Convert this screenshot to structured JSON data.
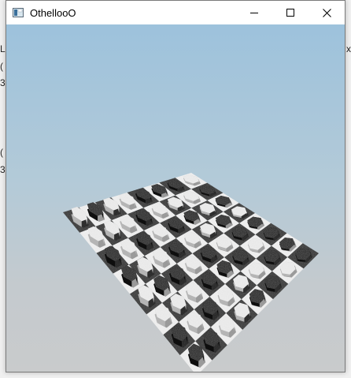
{
  "window": {
    "title": "OthellooO",
    "icon": "app-window-icon",
    "controls": [
      "minimize-icon",
      "maximize-icon",
      "close-icon"
    ]
  },
  "background_window": {
    "fragments": [
      "L",
      "(",
      "3",
      "(",
      "3",
      "x"
    ]
  },
  "board": {
    "size": 8,
    "colors": {
      "dark_square": "#2b2b2b",
      "light_square": "#f2f2f2",
      "black_piece": "#1e1e1e",
      "white_piece": "#eeeeee"
    },
    "rows": [
      "WBBWBBBB",
      "BWWBBWBW",
      "BWBWWBWB",
      "BWBWBBWB",
      "WBWBWBWW",
      "WWBWBWBW",
      "BWWWBWWB",
      "WWBBWWBB"
    ]
  }
}
